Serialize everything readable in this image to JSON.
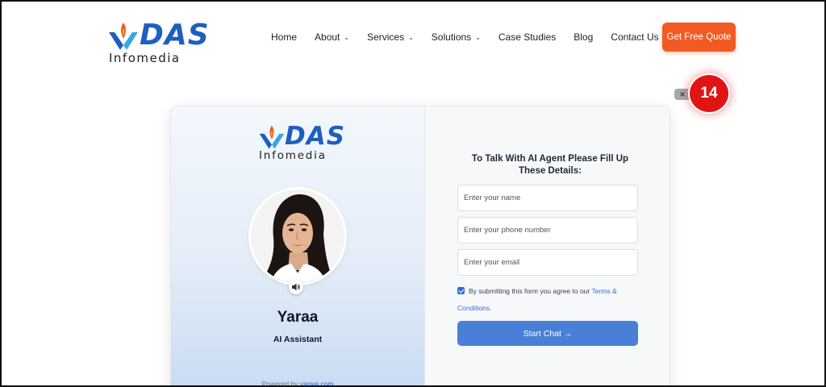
{
  "brand": {
    "name": "DAS",
    "tagline": "Infomedia"
  },
  "nav": {
    "items": [
      {
        "label": "Home",
        "dropdown": false
      },
      {
        "label": "About",
        "dropdown": true
      },
      {
        "label": "Services",
        "dropdown": true
      },
      {
        "label": "Solutions",
        "dropdown": true
      },
      {
        "label": "Case Studies",
        "dropdown": false
      },
      {
        "label": "Blog",
        "dropdown": false
      },
      {
        "label": "Contact Us",
        "dropdown": false
      }
    ],
    "cta_label": "Get Free Quote"
  },
  "widget": {
    "brand_name": "DAS",
    "brand_tagline": "Infomedia",
    "agent_name": "Yaraa",
    "agent_role": "AI Assistant",
    "powered_prefix": "Powered by",
    "powered_link": "yaraai.com",
    "form_title": "To Talk With AI Agent Please Fill Up These Details:",
    "name_placeholder": "Enter your name",
    "phone_placeholder": "Enter your phone number",
    "email_placeholder": "Enter your email",
    "consent_text": "By submitting this form you agree to our",
    "terms_label": "Terms & Conditions.",
    "consent_checked": true,
    "start_label": "Start Chat →"
  },
  "notification": {
    "count": "14",
    "close_label": "×"
  },
  "colors": {
    "brand_blue": "#1d5fbf",
    "cta_orange": "#f15a22",
    "button_blue": "#4a7fd8",
    "badge_red": "#e11414"
  }
}
